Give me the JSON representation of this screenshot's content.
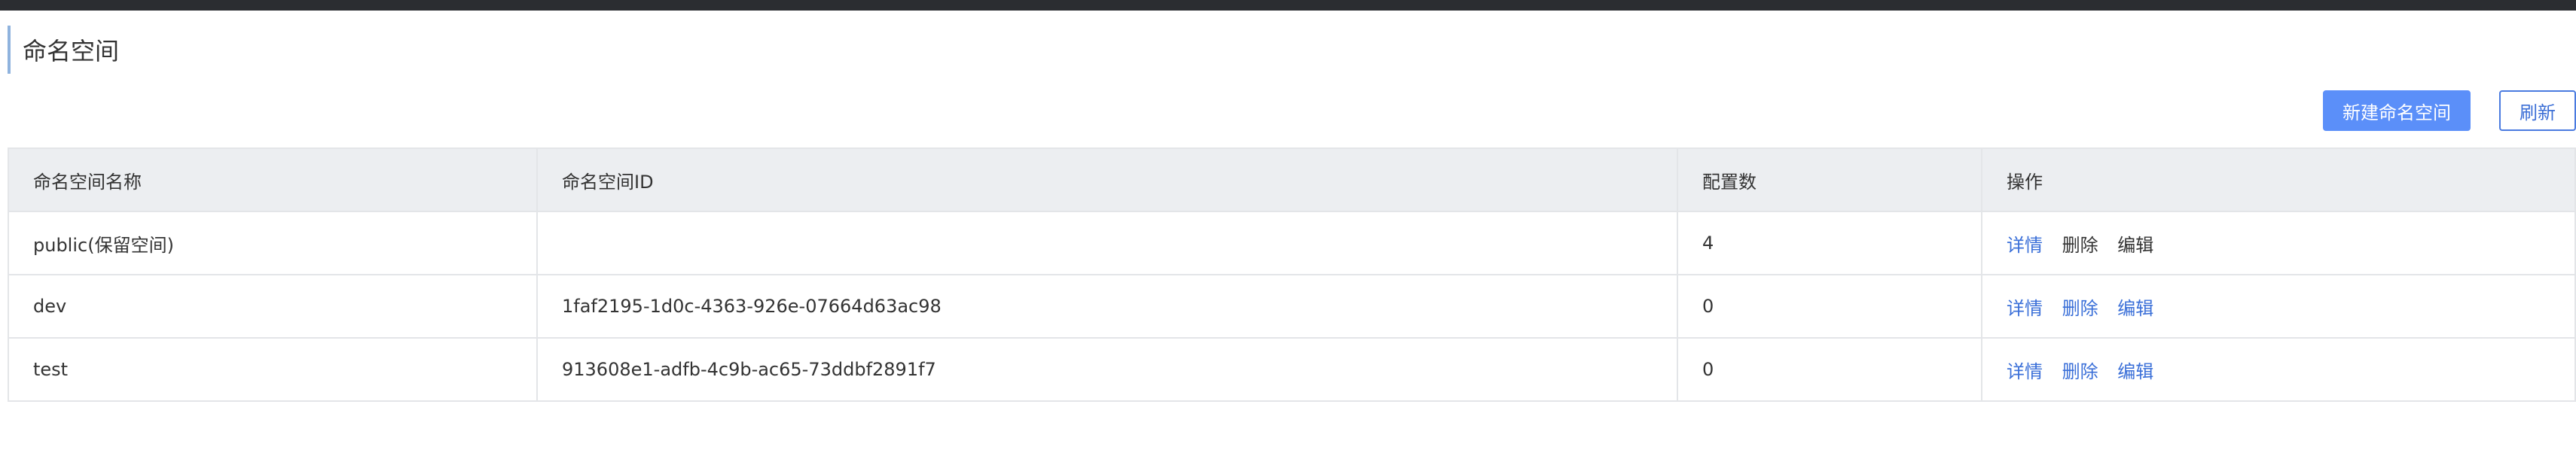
{
  "page": {
    "title": "命名空间"
  },
  "toolbar": {
    "new_label": "新建命名空间",
    "refresh_label": "刷新"
  },
  "table": {
    "headers": {
      "name": "命名空间名称",
      "id": "命名空间ID",
      "count": "配置数",
      "ops": "操作"
    },
    "rows": [
      {
        "name": "public(保留空间)",
        "id": "",
        "count": "4",
        "ops": {
          "detail": "详情",
          "delete": "删除",
          "edit": "编辑"
        }
      },
      {
        "name": "dev",
        "id": "1faf2195-1d0c-4363-926e-07664d63ac98",
        "count": "0",
        "ops": {
          "detail": "详情",
          "delete": "删除",
          "edit": "编辑"
        }
      },
      {
        "name": "test",
        "id": "913608e1-adfb-4c9b-ac65-73ddbf2891f7",
        "count": "0",
        "ops": {
          "detail": "详情",
          "delete": "删除",
          "edit": "编辑"
        }
      }
    ]
  },
  "colors": {
    "topbar": "#2b2d31",
    "primary": "#5b8ff9",
    "link": "#3a6fd8",
    "title_accent": "#8fb3de"
  }
}
